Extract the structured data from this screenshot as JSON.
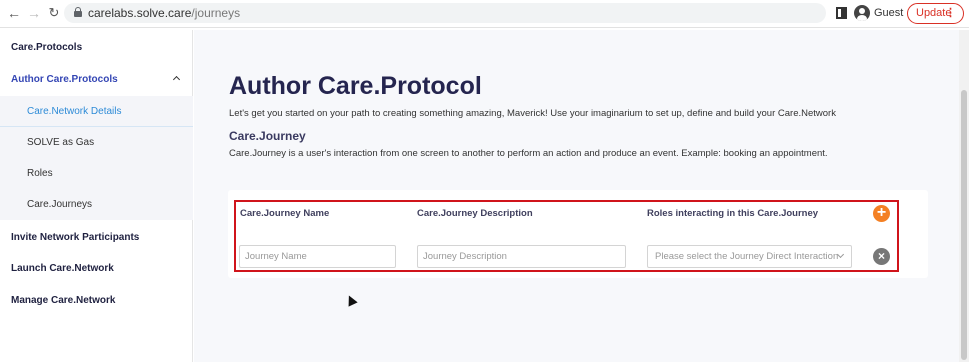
{
  "browser": {
    "url_host": "carelabs.solve.care",
    "url_path": "/journeys",
    "guest_label": "Guest",
    "update_label": "Update"
  },
  "sidebar": {
    "items": [
      {
        "label": "Care.Protocols"
      },
      {
        "label": "Author Care.Protocols"
      },
      {
        "label": "Care.Network Details"
      },
      {
        "label": "SOLVE as Gas"
      },
      {
        "label": "Roles"
      },
      {
        "label": "Care.Journeys"
      },
      {
        "label": "Invite Network Participants"
      },
      {
        "label": "Launch Care.Network"
      },
      {
        "label": "Manage Care.Network"
      }
    ]
  },
  "main": {
    "title": "Author Care.Protocol",
    "intro": "Let's get you started on your path to creating something amazing, Maverick! Use your imaginarium to set up, define and build your Care.Network",
    "section_title": "Care.Journey",
    "section_desc": "Care.Journey is a user's interaction from one screen to another to perform an action and produce an event. Example: booking an appointment.",
    "table": {
      "headers": [
        "Care.Journey Name",
        "Care.Journey Description",
        "Roles interacting in this Care.Journey"
      ],
      "name_placeholder": "Journey Name",
      "description_placeholder": "Journey Description",
      "roles_placeholder": "Please select the Journey Direct Interaction"
    }
  },
  "colors": {
    "accent_orange": "#f48024",
    "highlight_red": "#d0141b",
    "title_navy": "#25254f",
    "active_blue": "#2d8bd7"
  }
}
